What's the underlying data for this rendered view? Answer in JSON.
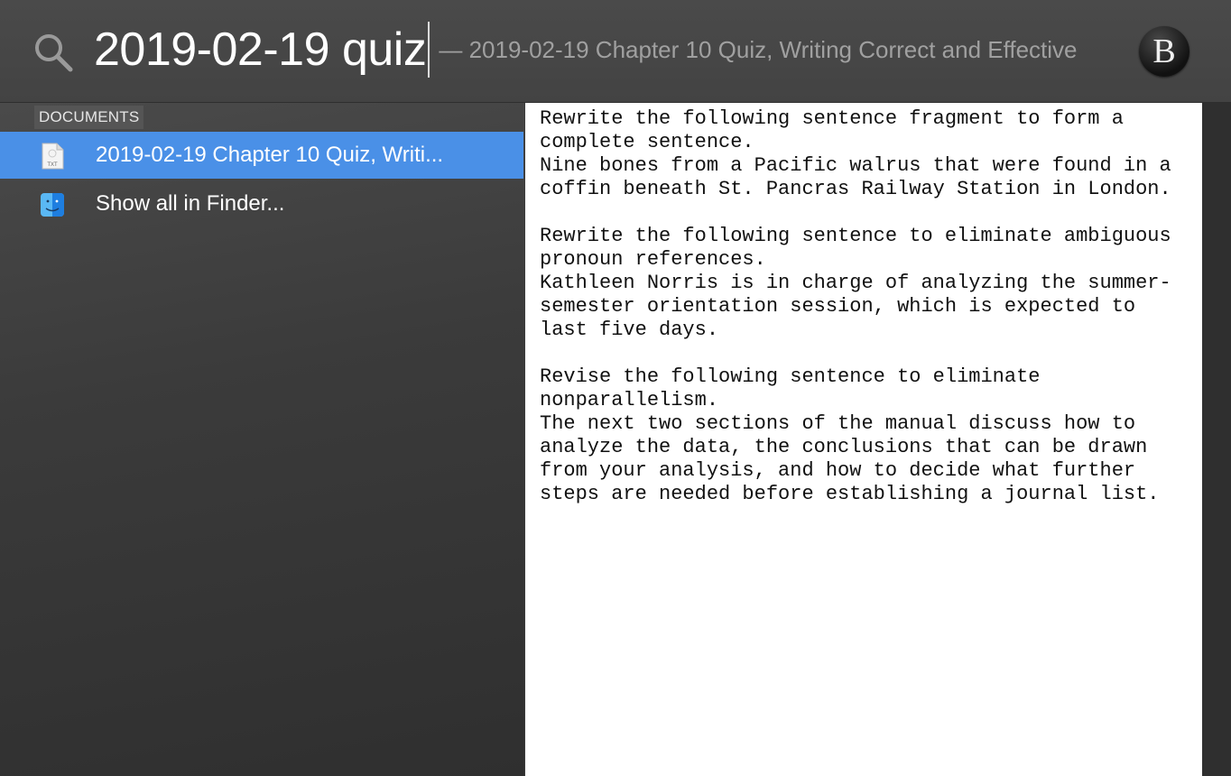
{
  "search": {
    "query": "2019-02-19 quiz",
    "hint": "— 2019-02-19 Chapter 10 Quiz, Writing Correct and Effective"
  },
  "account": {
    "avatar_letter": "B"
  },
  "results": {
    "section_header": "DOCUMENTS",
    "items": [
      {
        "label": "2019-02-19 Chapter 10 Quiz, Writi...",
        "icon": "txt-file-icon",
        "selected": true
      },
      {
        "label": "Show all in Finder...",
        "icon": "finder-icon",
        "selected": false
      }
    ]
  },
  "preview": {
    "lines": [
      "Rewrite the following sentence fragment to form a",
      "complete sentence.",
      "Nine bones from a Pacific walrus that were found in a",
      "coffin beneath St. Pancras Railway Station in London.",
      "",
      "Rewrite the following sentence to eliminate ambiguous",
      "pronoun references.",
      "Kathleen Norris is in charge of analyzing the summer-",
      "semester orientation session, which is expected to",
      "last five days.",
      "",
      "Revise the following sentence to eliminate",
      "nonparallelism.",
      "The next two sections of the manual discuss how to",
      "analyze the data, the conclusions that can be drawn",
      "from your analysis, and how to decide what further",
      "steps are needed before establishing a journal list."
    ]
  },
  "colors": {
    "selection": "#4a90e7",
    "background": "#3d3d3d",
    "preview_bg": "#ffffff"
  }
}
